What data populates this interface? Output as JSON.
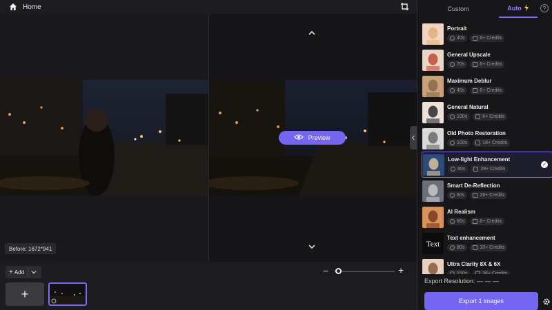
{
  "topbar": {
    "home_label": "Home"
  },
  "canvas": {
    "preview_label": "Preview",
    "before_label": "Before: 1672*941"
  },
  "bottom": {
    "add_label": "Add",
    "add_tile": "+"
  },
  "zoom": {
    "minus": "−",
    "plus": "+",
    "level": 0.0
  },
  "panel": {
    "tab_custom": "Custom",
    "tab_auto": "Auto",
    "help": "?",
    "items": [
      {
        "title": "Portrait",
        "time": "40s",
        "credits": "6+ Credits",
        "selected": false
      },
      {
        "title": "General Upscale",
        "time": "70s",
        "credits": "6+ Credits",
        "selected": false
      },
      {
        "title": "Maximum Deblur",
        "time": "40s",
        "credits": "6+ Credits",
        "selected": false
      },
      {
        "title": "General Natural",
        "time": "100s",
        "credits": "6+ Credits",
        "selected": false
      },
      {
        "title": "Old Photo Restoration",
        "time": "100s",
        "credits": "16+ Credits",
        "selected": false
      },
      {
        "title": "Low-light Enhancement",
        "time": "80s",
        "credits": "28+ Credits",
        "selected": true
      },
      {
        "title": "Smart De-Reflection",
        "time": "80s",
        "credits": "28+ Credits",
        "selected": false
      },
      {
        "title": "AI Realism",
        "time": "80s",
        "credits": "8+ Credits",
        "selected": false
      },
      {
        "title": "Text enhancement",
        "time": "80s",
        "credits": "10+ Credits",
        "selected": false
      },
      {
        "title": "Ultra Clarity 8X & 6X",
        "time": "150s",
        "credits": "36+ Credits",
        "selected": false
      }
    ],
    "export_resolution": "Export Resolution: — — —",
    "export_button": "Export 1 images"
  },
  "colors": {
    "accent": "#7466f0",
    "background": "#1f1f22",
    "panel": "#17171a"
  }
}
